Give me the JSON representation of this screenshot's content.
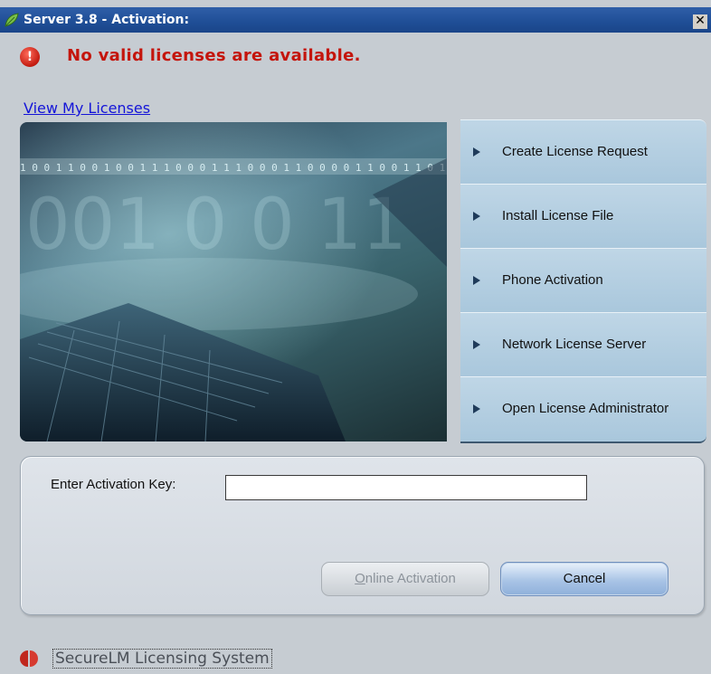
{
  "window": {
    "title": "Server 3.8 - Activation:",
    "close_glyph": "✕",
    "icon": "app-leaf-icon"
  },
  "error": {
    "icon": "error-circle-icon",
    "icon_glyph": "!",
    "message": "No valid licenses are available."
  },
  "link": {
    "view_licenses": "View My Licenses"
  },
  "menu": {
    "items": [
      {
        "label": "Create License Request",
        "icon": "arrow-right-icon"
      },
      {
        "label": "Install License File",
        "icon": "arrow-right-icon"
      },
      {
        "label": "Phone Activation",
        "icon": "arrow-right-icon"
      },
      {
        "label": "Network License Server",
        "icon": "arrow-right-icon"
      },
      {
        "label": "Open License Administrator",
        "icon": "arrow-right-icon"
      }
    ]
  },
  "hero": {
    "binary_line": "1 0 0 1 1 0 0 1 0 0 1 1 1 0 0 0 1 1 1 0 0 0 1 1 0 0 0 0 1 1 0 0 1 1 0 1 0 1 0 0",
    "big_digits": "001 0 0 11"
  },
  "activation": {
    "label": "Enter Activation Key:",
    "value": "",
    "placeholder": ""
  },
  "buttons": {
    "online_prefix": "",
    "online_mnemonic": "O",
    "online_rest": "nline Activation",
    "cancel": "Cancel"
  },
  "footer": {
    "brand": "SecureLM Licensing System",
    "logo": "securelm-logo-icon"
  },
  "colors": {
    "titlebar": "#1f4e96",
    "error_text": "#c4150c",
    "link": "#1414d8",
    "menu_bg": "#a9c7dc"
  }
}
